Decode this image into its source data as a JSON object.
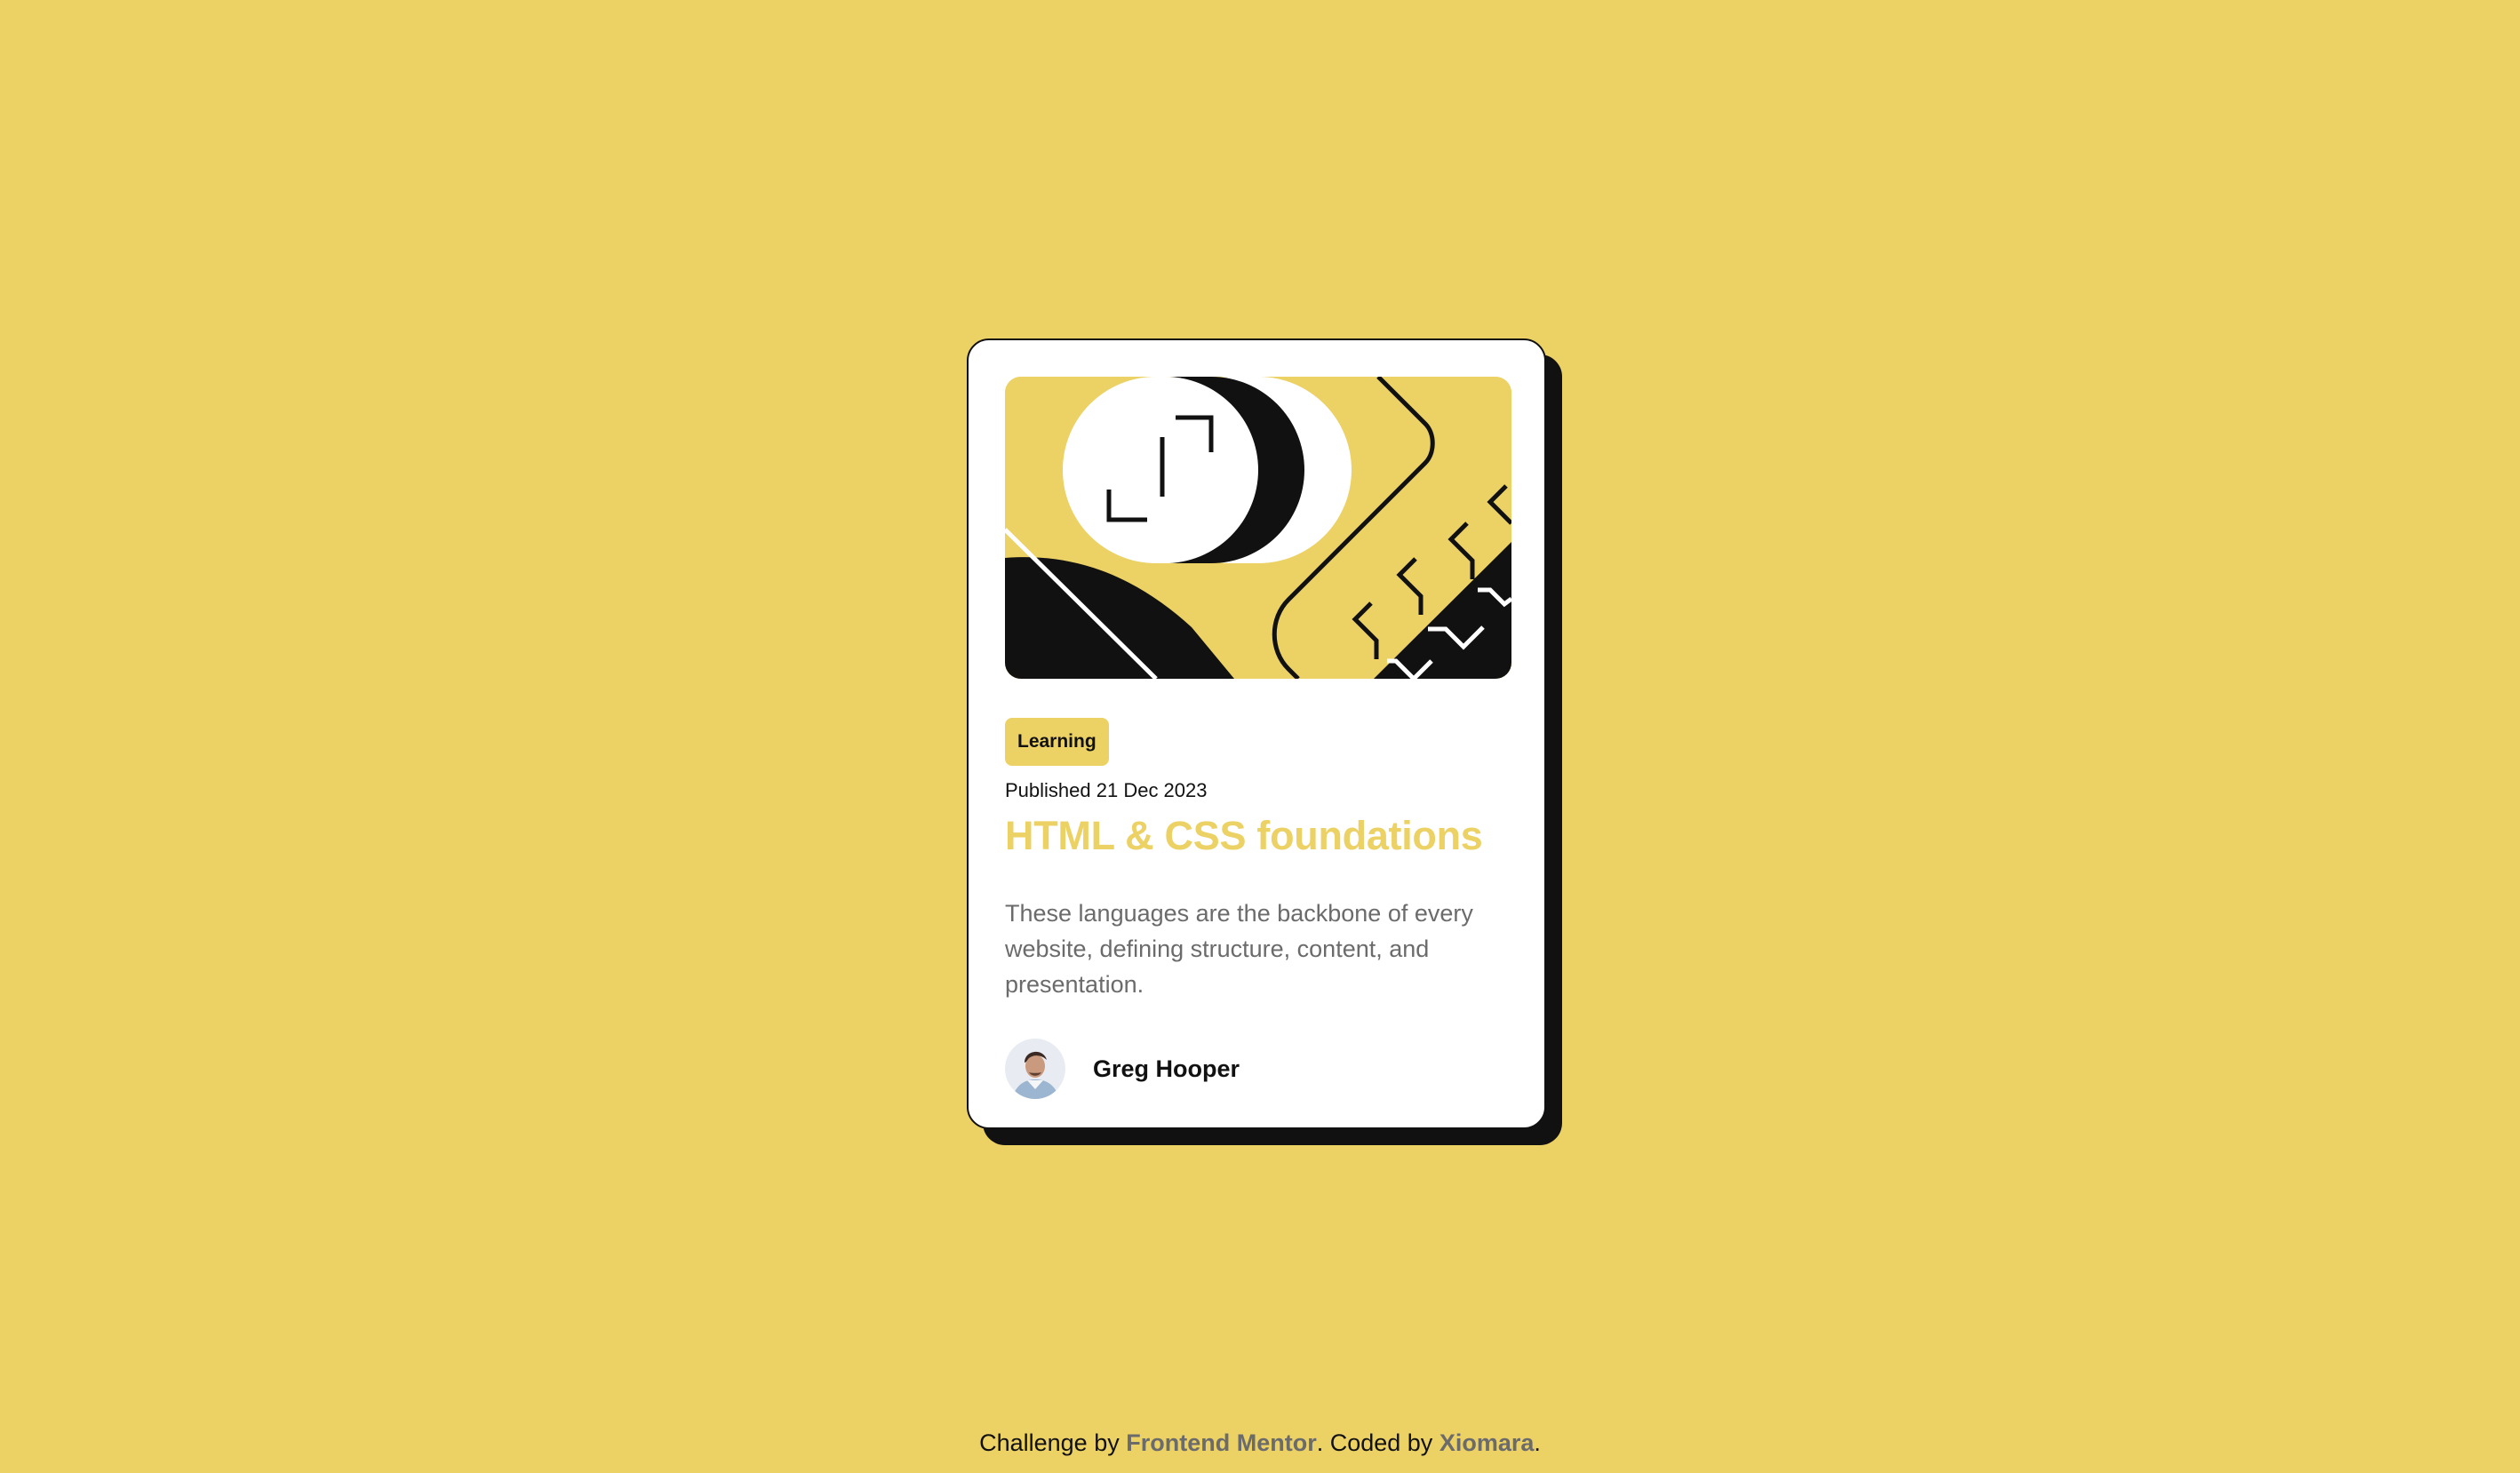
{
  "colors": {
    "page_background": "#ECD165",
    "card_background": "#FFFFFF",
    "accent_yellow": "#ECD165",
    "ink": "#111111",
    "muted_text": "#6B6B6B"
  },
  "card": {
    "illustration_icon": "blog-illustration",
    "tag": "Learning",
    "published": "Published 21 Dec 2023",
    "title": "HTML & CSS foundations",
    "description": "These languages are the backbone of every website, defining structure, content, and presentation.",
    "author": {
      "avatar_icon": "author-avatar",
      "name": "Greg Hooper"
    }
  },
  "attribution": {
    "prefix": "Challenge by ",
    "frontend_mentor_link": "Frontend Mentor",
    "middle": ". Coded by ",
    "author_link": "Xiomara",
    "suffix": "."
  }
}
